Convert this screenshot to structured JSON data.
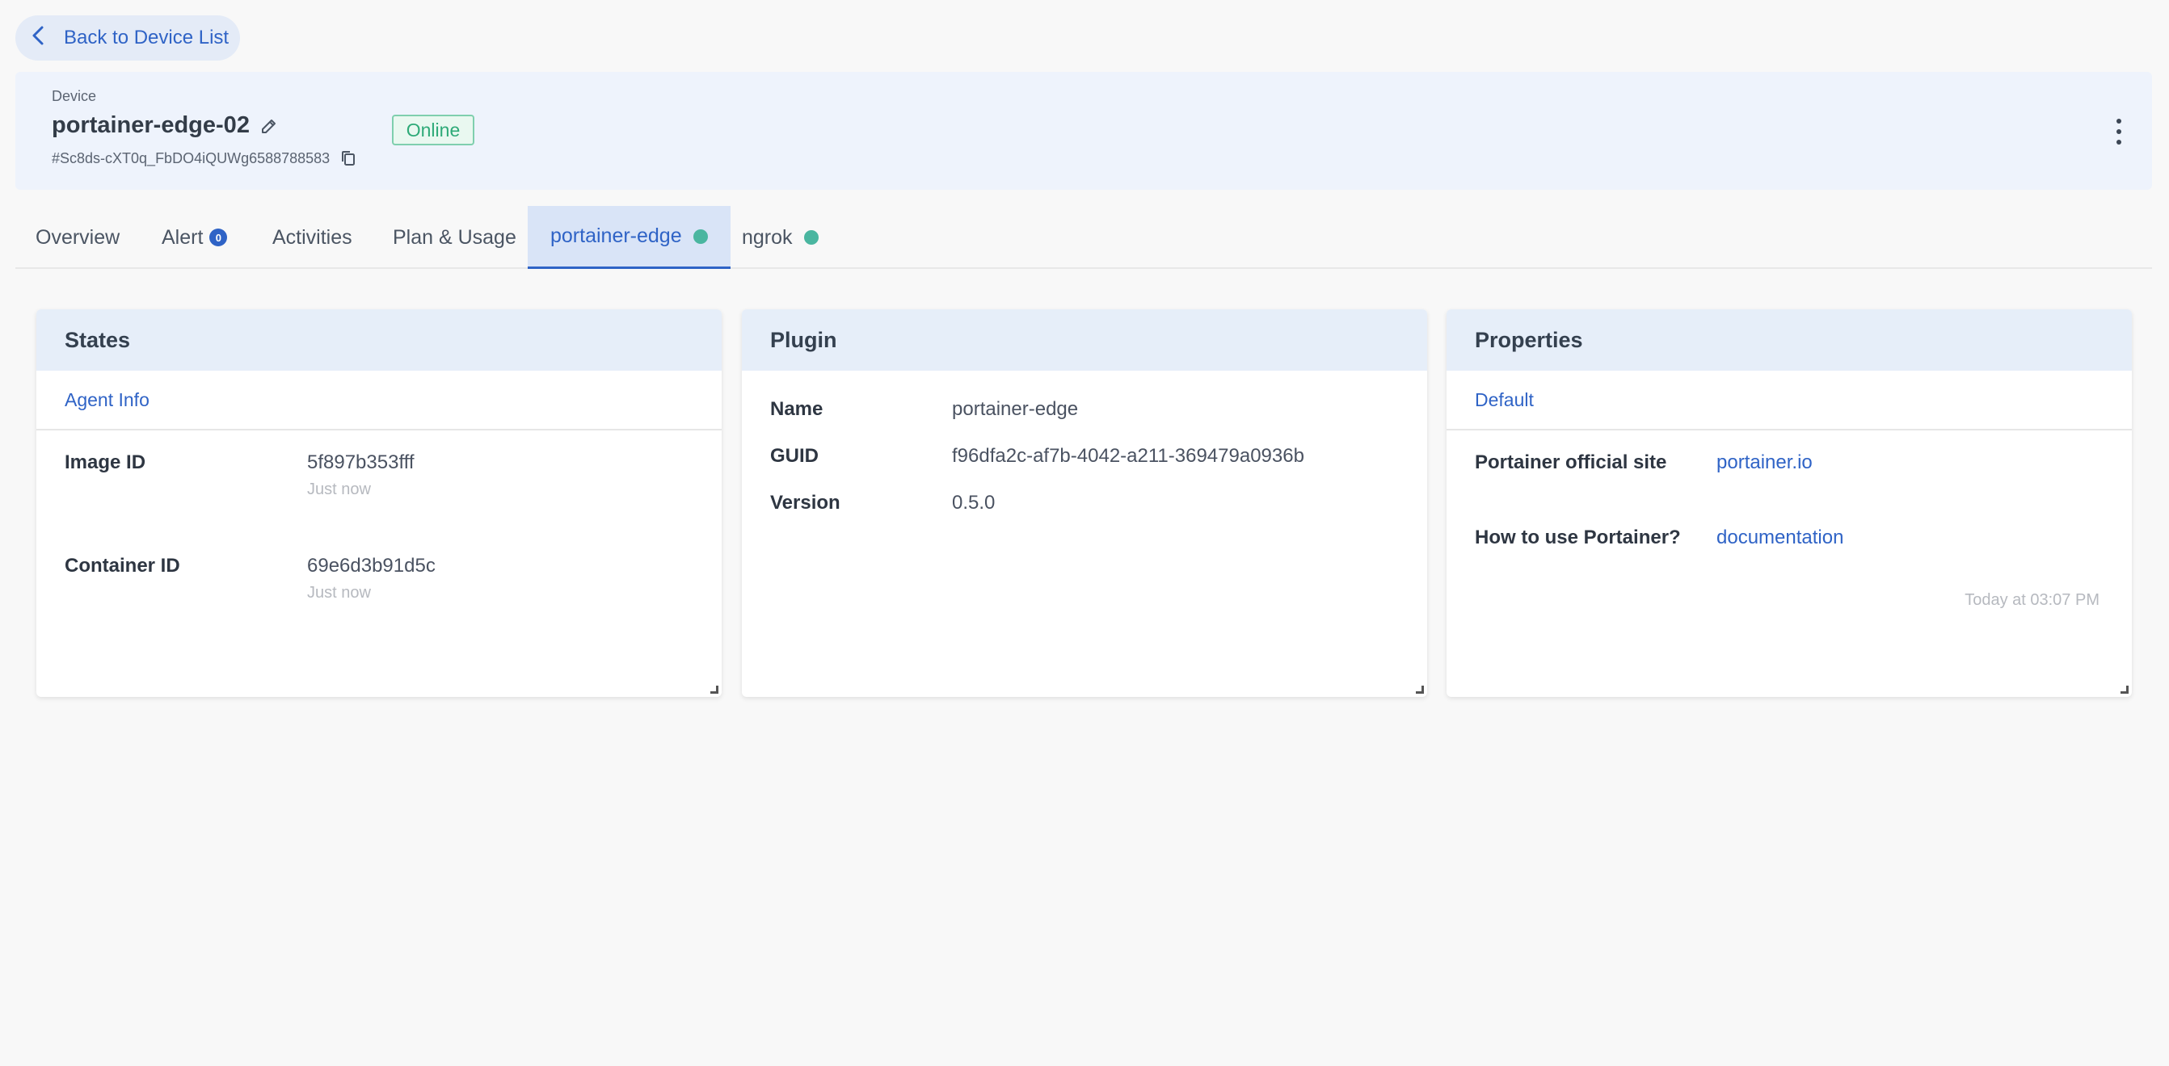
{
  "nav": {
    "back_label": "Back to Device List"
  },
  "device": {
    "label": "Device",
    "name": "portainer-edge-02",
    "id": "#Sc8ds-cXT0q_FbDO4iQUWg6588788583",
    "status": "Online"
  },
  "tabs": [
    {
      "label": "Overview"
    },
    {
      "label": "Alert",
      "count": "0"
    },
    {
      "label": "Activities"
    },
    {
      "label": "Plan & Usage"
    },
    {
      "label": "portainer-edge",
      "active": true
    },
    {
      "label": "ngrok"
    }
  ],
  "states_card": {
    "title": "States",
    "subtab": "Agent Info",
    "rows": [
      {
        "key": "Image ID",
        "value": "5f897b353fff",
        "updated": "Just now"
      },
      {
        "key": "Container ID",
        "value": "69e6d3b91d5c",
        "updated": "Just now"
      }
    ]
  },
  "plugin_card": {
    "title": "Plugin",
    "rows": [
      {
        "key": "Name",
        "value": "portainer-edge"
      },
      {
        "key": "GUID",
        "value": "f96dfa2c-af7b-4042-a211-369479a0936b"
      },
      {
        "key": "Version",
        "value": "0.5.0"
      }
    ]
  },
  "properties_card": {
    "title": "Properties",
    "subtab": "Default",
    "rows": [
      {
        "key": "Portainer official site",
        "value": "portainer.io"
      },
      {
        "key": "How to use Portainer?",
        "value": "documentation"
      }
    ],
    "timestamp": "Today at 03:07 PM"
  },
  "colors": {
    "accent": "#2f63c6",
    "online": "#2eaa78",
    "status_dot": "#4ab6a0",
    "card_header": "#e6eef9"
  }
}
